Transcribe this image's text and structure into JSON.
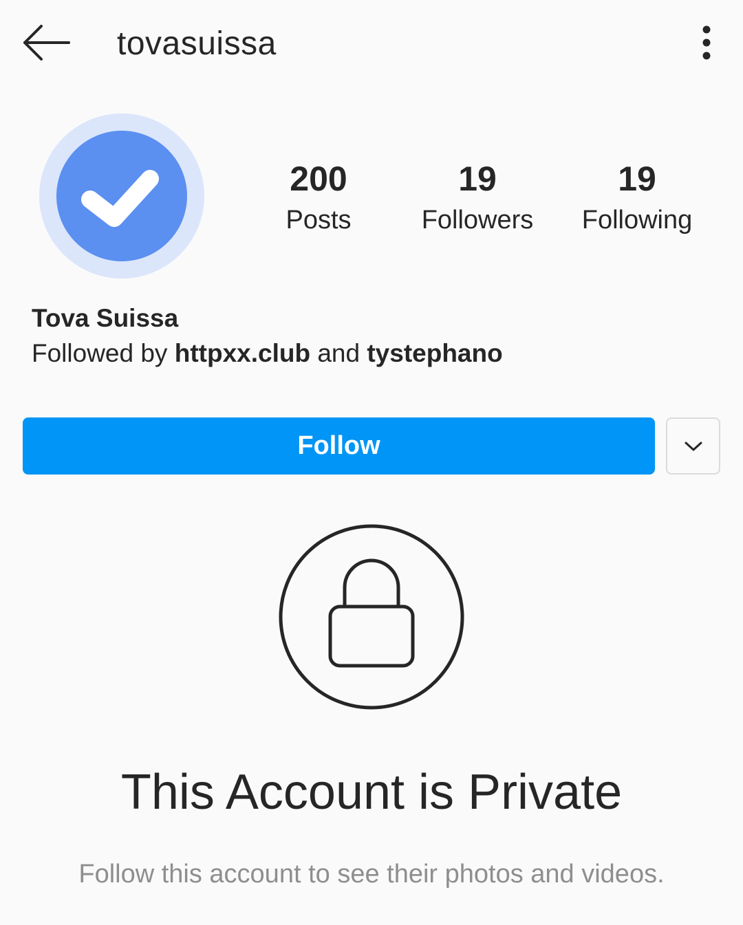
{
  "header": {
    "username": "tovasuissa",
    "back_icon": "arrow-left-icon",
    "more_icon": "vertical-ellipsis-icon"
  },
  "profile": {
    "avatar_icon": "verified-check-icon",
    "full_name": "Tova Suissa",
    "followed_by_prefix": "Followed by ",
    "followed_by_user1": "httpxx.club",
    "followed_by_conjunction": " and ",
    "followed_by_user2": "tystephano"
  },
  "stats": {
    "posts": {
      "value": "200",
      "label": "Posts"
    },
    "followers": {
      "value": "19",
      "label": "Followers"
    },
    "following": {
      "value": "19",
      "label": "Following"
    }
  },
  "actions": {
    "follow_label": "Follow",
    "dropdown_icon": "chevron-down-icon"
  },
  "private_notice": {
    "icon": "lock-icon",
    "title": "This Account is Private",
    "subtitle": "Follow this account to see their photos and videos."
  },
  "colors": {
    "background": "#fafafa",
    "follow_button": "#0095f6",
    "avatar_ring": "#dbe6fb",
    "avatar_fill": "#5b8ff0",
    "text_primary": "#262626",
    "text_secondary": "#8e8e8e"
  }
}
